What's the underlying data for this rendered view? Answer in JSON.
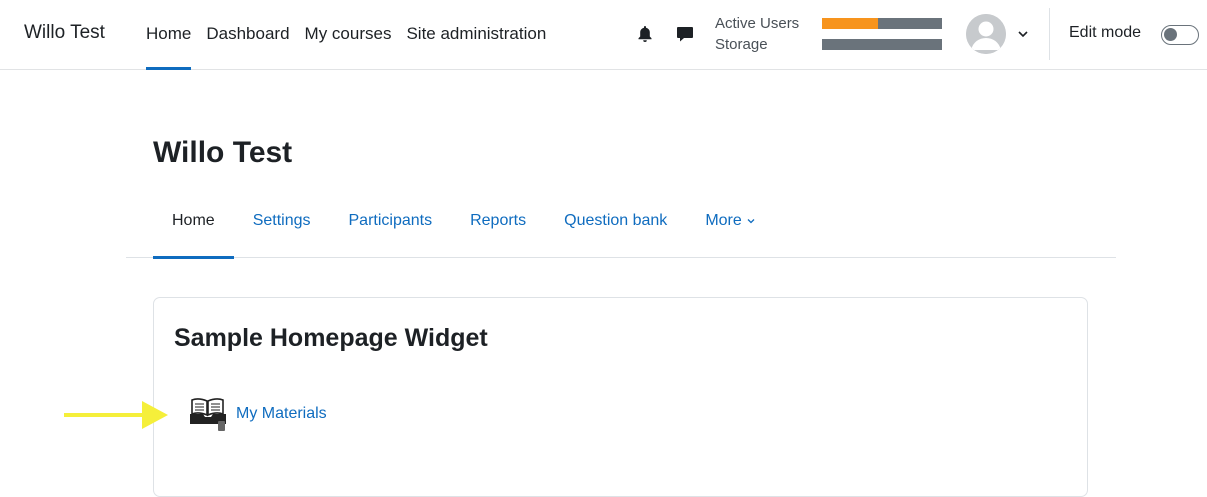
{
  "navbar": {
    "brand": "Willo Test",
    "items": [
      {
        "label": "Home",
        "active": true
      },
      {
        "label": "Dashboard",
        "active": false
      },
      {
        "label": "My courses",
        "active": false
      },
      {
        "label": "Site administration",
        "active": false
      }
    ],
    "usage": {
      "active_users_label": "Active Users",
      "active_users_fraction": 0.47,
      "storage_label": "Storage",
      "storage_fraction": 0.0
    },
    "edit_mode_label": "Edit mode",
    "edit_mode_on": false,
    "icons": [
      "bell-icon",
      "message-icon",
      "user-avatar",
      "chevron-down-icon"
    ]
  },
  "page": {
    "title": "Willo Test"
  },
  "secondary_nav": {
    "items": [
      {
        "label": "Home",
        "active": true
      },
      {
        "label": "Settings",
        "active": false
      },
      {
        "label": "Participants",
        "active": false
      },
      {
        "label": "Reports",
        "active": false
      },
      {
        "label": "Question bank",
        "active": false
      },
      {
        "label": "More",
        "active": false
      }
    ]
  },
  "widget": {
    "title": "Sample Homepage Widget",
    "link_label": "My Materials",
    "link_icon": "book-icon"
  },
  "colors": {
    "accent": "#0f6cbf",
    "usage_fill": "#f7941d",
    "usage_track": "#6a737b",
    "annotation_arrow": "#f5ef3a"
  }
}
